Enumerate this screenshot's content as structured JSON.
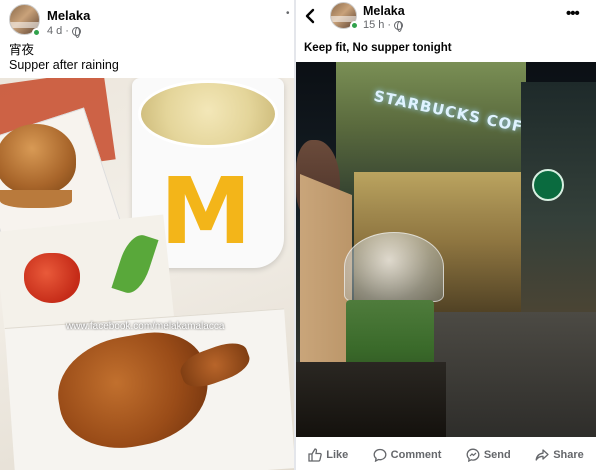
{
  "left_post": {
    "author": "Melaka",
    "time": "4 d",
    "separator": "·",
    "text_line1": "宵夜",
    "text_line2": "Supper after raining",
    "watermark": "www.facebook.com/melakamalacca",
    "header_dot": "•"
  },
  "right_post": {
    "author": "Melaka",
    "time": "15 h",
    "separator": "·",
    "text": "Keep fit, No supper tonight",
    "more": "•••"
  },
  "actions": [
    {
      "label": "Like",
      "icon": "like-icon"
    },
    {
      "label": "Comment",
      "icon": "comment-icon"
    },
    {
      "label": "Send",
      "icon": "send-icon"
    },
    {
      "label": "Share",
      "icon": "share-icon"
    }
  ],
  "colors": {
    "online": "#31a24c",
    "secondary_text": "#65676b",
    "primary_text": "#050505"
  }
}
